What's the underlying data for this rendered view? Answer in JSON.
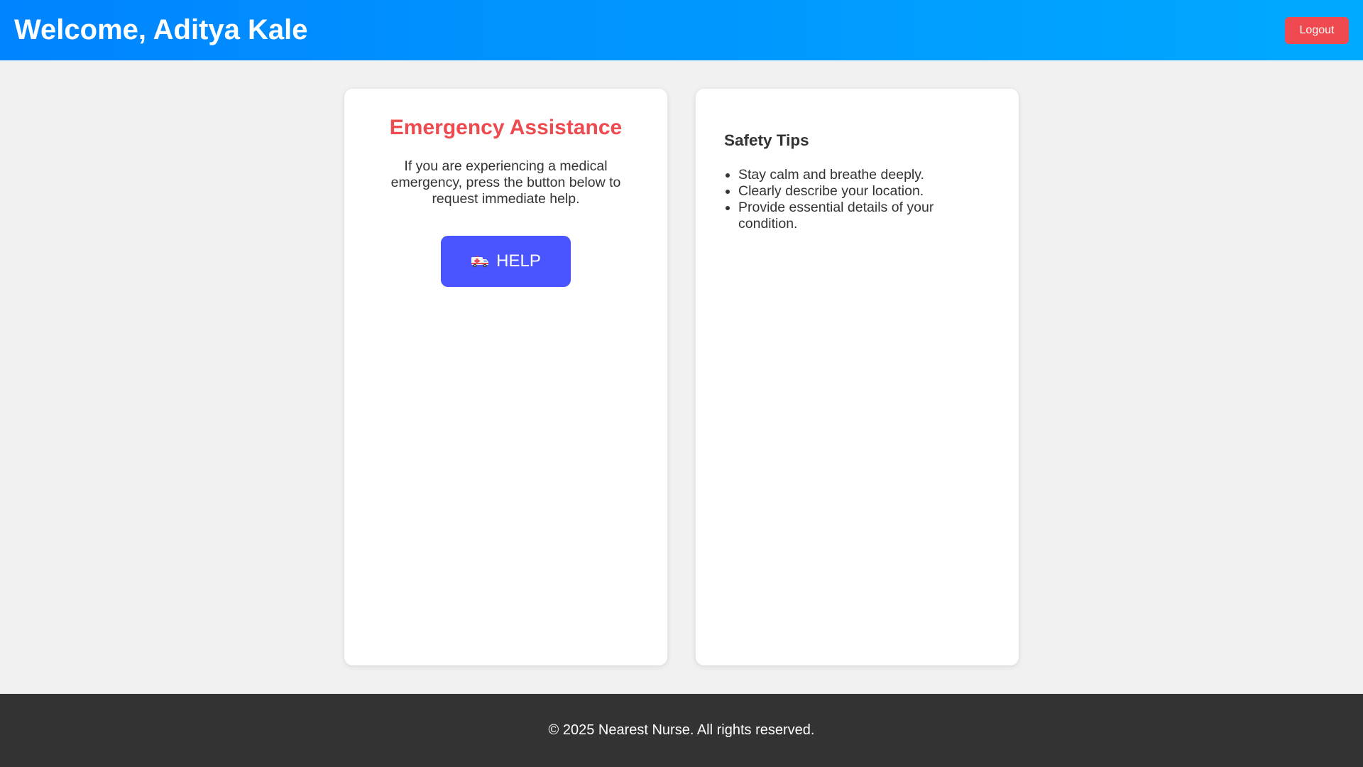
{
  "header": {
    "welcome_text": "Welcome, Aditya Kale",
    "logout_label": "Logout",
    "gradient_start": "#0084ff",
    "gradient_end": "#00aaff",
    "logout_color": "#ef4a4f"
  },
  "emergency": {
    "title": "Emergency Assistance",
    "description": "If you are experiencing a medical emergency, press the button below to request immediate help.",
    "help_icon": "ambulance-icon",
    "help_label": "HELP",
    "title_color": "#ef4a4f",
    "button_color": "#4b55ff"
  },
  "safety_tips": {
    "title": "Safety Tips",
    "items": [
      "Stay calm and breathe deeply.",
      "Clearly describe your location.",
      "Provide essential details of your condition."
    ]
  },
  "footer": {
    "text": "© 2025 Nearest Nurse. All rights reserved.",
    "background_color": "#333333"
  }
}
